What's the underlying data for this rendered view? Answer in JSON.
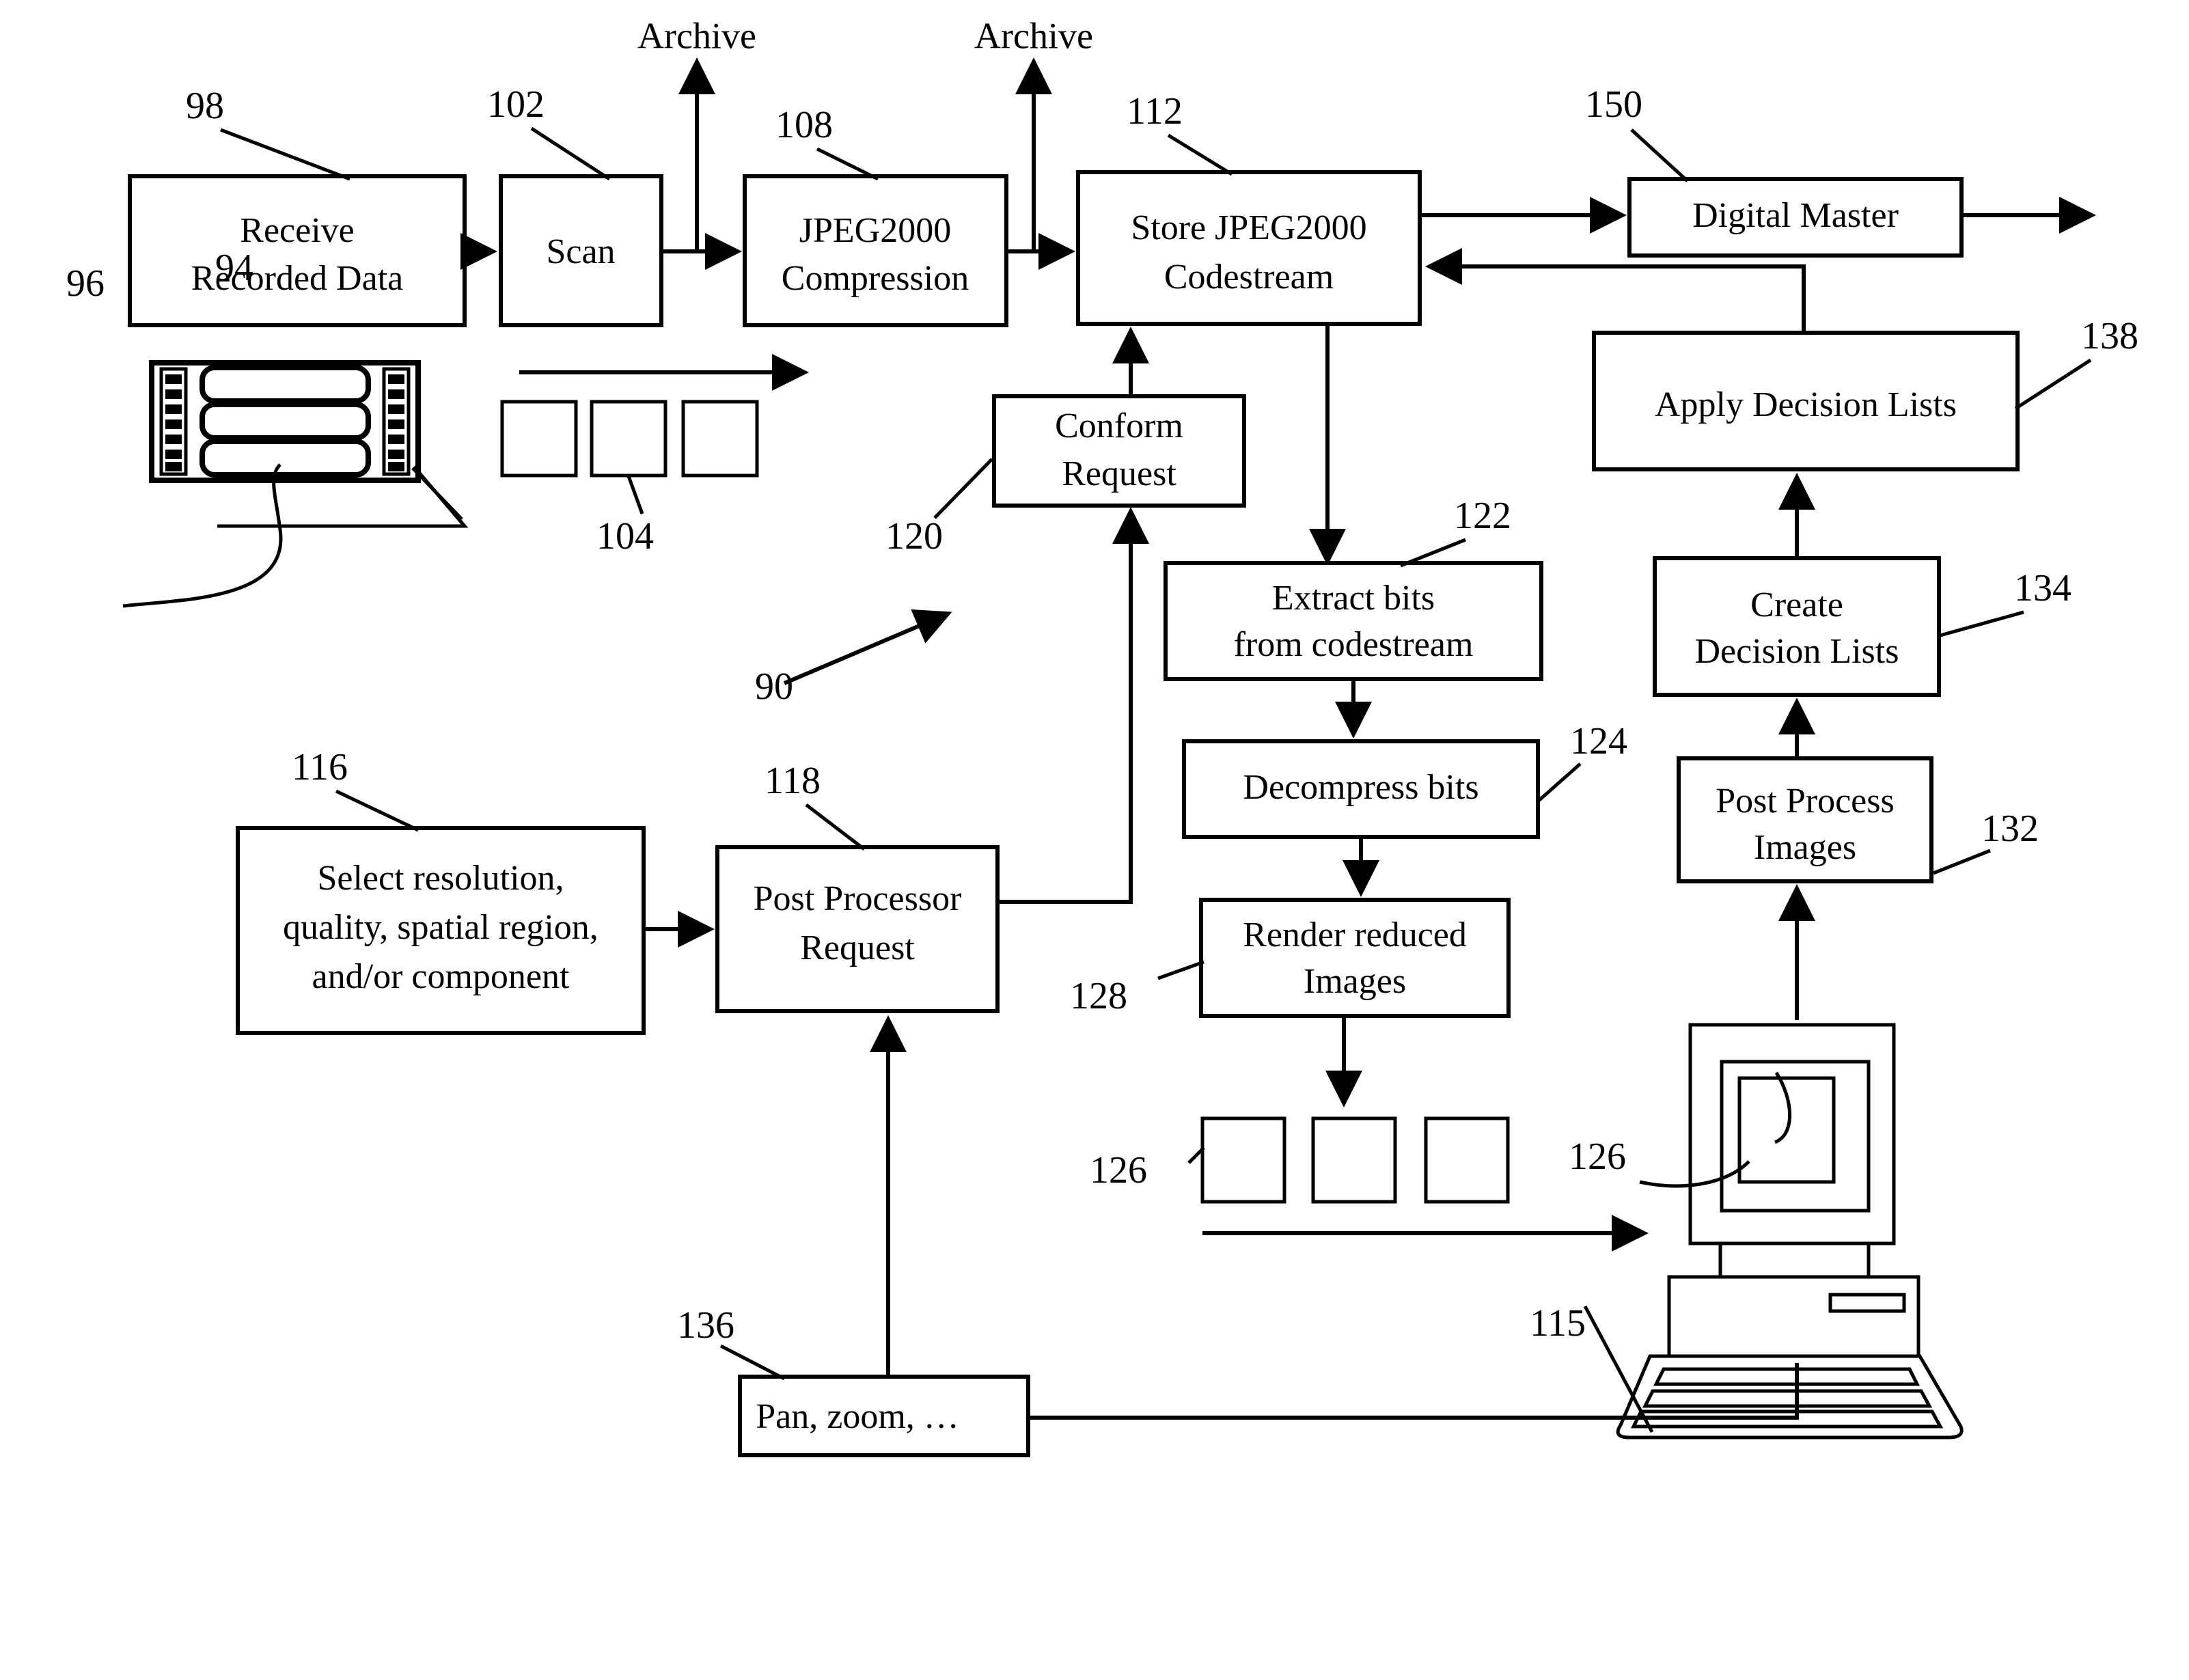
{
  "figure": {
    "kind": "patent-flow-diagram",
    "overall_ref": "90"
  },
  "boxes": [
    {
      "id": "receive",
      "ref": "98",
      "lines": [
        "Receive",
        "Recorded Data"
      ]
    },
    {
      "id": "scan",
      "ref": "102",
      "lines": [
        "Scan"
      ]
    },
    {
      "id": "compress",
      "ref": "108",
      "lines": [
        "JPEG2000",
        "Compression"
      ]
    },
    {
      "id": "store",
      "ref": "112",
      "lines": [
        "Store JPEG2000",
        "Codestream"
      ]
    },
    {
      "id": "master",
      "ref": "150",
      "lines": [
        "Digital Master"
      ]
    },
    {
      "id": "applydl",
      "ref": "138",
      "lines": [
        "Apply Decision Lists"
      ]
    },
    {
      "id": "conform",
      "ref": "120",
      "lines": [
        "Conform",
        "Request"
      ]
    },
    {
      "id": "extract",
      "ref": "122",
      "lines": [
        "Extract bits",
        "from codestream"
      ]
    },
    {
      "id": "decomp",
      "ref": "124",
      "lines": [
        "Decompress bits"
      ]
    },
    {
      "id": "render",
      "ref": "128",
      "lines": [
        "Render reduced",
        "Images"
      ]
    },
    {
      "id": "createdl",
      "ref": "134",
      "lines": [
        "Create",
        "Decision Lists"
      ]
    },
    {
      "id": "postproc",
      "ref": "132",
      "lines": [
        "Post Process",
        "Images"
      ]
    },
    {
      "id": "select",
      "ref": "116",
      "lines": [
        "Select resolution,",
        "quality, spatial region,",
        "and/or component"
      ]
    },
    {
      "id": "ppreq",
      "ref": "118",
      "lines": [
        "Post Processor",
        "Request"
      ]
    },
    {
      "id": "panzoom",
      "ref": "136",
      "lines": [
        "Pan, zoom, …"
      ]
    }
  ],
  "archive_outputs": [
    {
      "id": "archive-1",
      "label": "Archive"
    },
    {
      "id": "archive-2",
      "label": "Archive"
    }
  ],
  "pictorials": [
    {
      "id": "filmstrip",
      "refs": [
        "94",
        "96"
      ],
      "frames": 3
    },
    {
      "id": "frames-top",
      "refs": [
        "104"
      ],
      "frames": 3
    },
    {
      "id": "frames-bottom",
      "refs": [
        "126"
      ],
      "frames": 3
    },
    {
      "id": "workstation",
      "refs": [
        "126",
        "115"
      ]
    }
  ],
  "reference_numerals": [
    "98",
    "102",
    "108",
    "112",
    "150",
    "138",
    "134",
    "132",
    "120",
    "122",
    "124",
    "128",
    "126",
    "116",
    "118",
    "136",
    "115",
    "104",
    "94",
    "96",
    "90"
  ],
  "colors": {
    "ink": "#000000",
    "paper": "#ffffff"
  }
}
